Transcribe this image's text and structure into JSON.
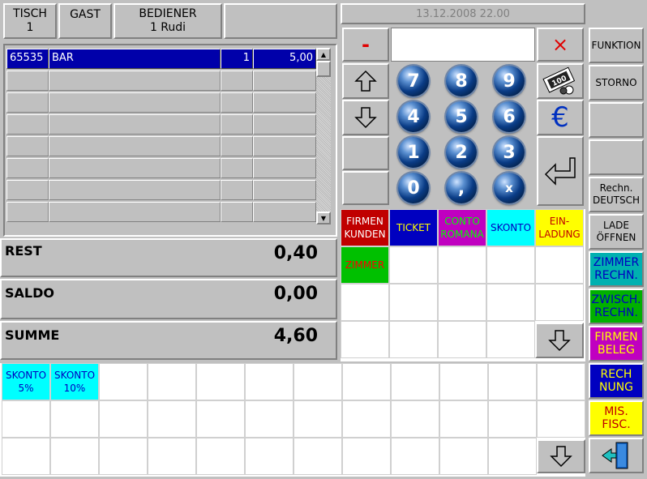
{
  "header": {
    "table_label": "TISCH",
    "table_value": "1",
    "guest_label": "GAST",
    "waiter_label": "BEDIENER",
    "waiter_value": "1 Rudi",
    "datetime": "13.12.2008  22.00"
  },
  "order": {
    "rows": [
      {
        "code": "65535",
        "name": "BAR",
        "qty": "1",
        "price": "5,00",
        "selected": true
      }
    ]
  },
  "totals": {
    "rest_label": "REST",
    "rest_value": "0,40",
    "saldo_label": "SALDO",
    "saldo_value": "0,00",
    "summe_label": "SUMME",
    "summe_value": "4,60"
  },
  "keypad": {
    "minus": "-",
    "close": "×",
    "keys": [
      "7",
      "8",
      "9",
      "4",
      "5",
      "6",
      "1",
      "2",
      "3",
      "0",
      ",",
      "x"
    ],
    "euro": "€"
  },
  "payment_tiles": [
    {
      "label": "FIRMEN\nKUNDEN",
      "bg": "#c00000",
      "fg": "#ffffff"
    },
    {
      "label": "TICKET",
      "bg": "#0000c0",
      "fg": "#ffff00"
    },
    {
      "label": "CONTO\nROMANA",
      "bg": "#c000c0",
      "fg": "#00ff00"
    },
    {
      "label": "SKONTO",
      "bg": "#00ffff",
      "fg": "#0000c0"
    },
    {
      "label": "EIN-\nLADUNG",
      "bg": "#ffff00",
      "fg": "#c00000"
    },
    {
      "label": "ZIMMER",
      "bg": "#00c000",
      "fg": "#ff0000"
    }
  ],
  "discount_tiles": [
    {
      "label": "SKONTO\n5%",
      "bg": "#00ffff",
      "fg": "#0000c0"
    },
    {
      "label": "SKONTO\n10%",
      "bg": "#00ffff",
      "fg": "#0000c0"
    }
  ],
  "sidebar": [
    {
      "label": "FUNKTION",
      "bg": "#c0c0c0",
      "fg": "#000000"
    },
    {
      "label": "STORNO",
      "bg": "#c0c0c0",
      "fg": "#000000"
    },
    {
      "label": "",
      "bg": "#c0c0c0",
      "fg": "#000000"
    },
    {
      "label": "",
      "bg": "#c0c0c0",
      "fg": "#000000"
    },
    {
      "label": "Rechn.\nDEUTSCH",
      "bg": "#c0c0c0",
      "fg": "#000000"
    },
    {
      "label": "LADE\nÖFFNEN",
      "bg": "#c0c0c0",
      "fg": "#000000"
    },
    {
      "label": "ZIMMER\nRECHN.",
      "bg": "#00b0b0",
      "fg": "#0000c0"
    },
    {
      "label": "ZWISCH.\nRECHN.",
      "bg": "#00b000",
      "fg": "#0000c0"
    },
    {
      "label": "FIRMEN\nBELEG",
      "bg": "#c000c0",
      "fg": "#ffff00"
    },
    {
      "label": "RECH\nNUNG",
      "bg": "#0000c0",
      "fg": "#ffff00"
    },
    {
      "label": "MIS.\nFISC.",
      "bg": "#ffff00",
      "fg": "#c00000"
    }
  ]
}
